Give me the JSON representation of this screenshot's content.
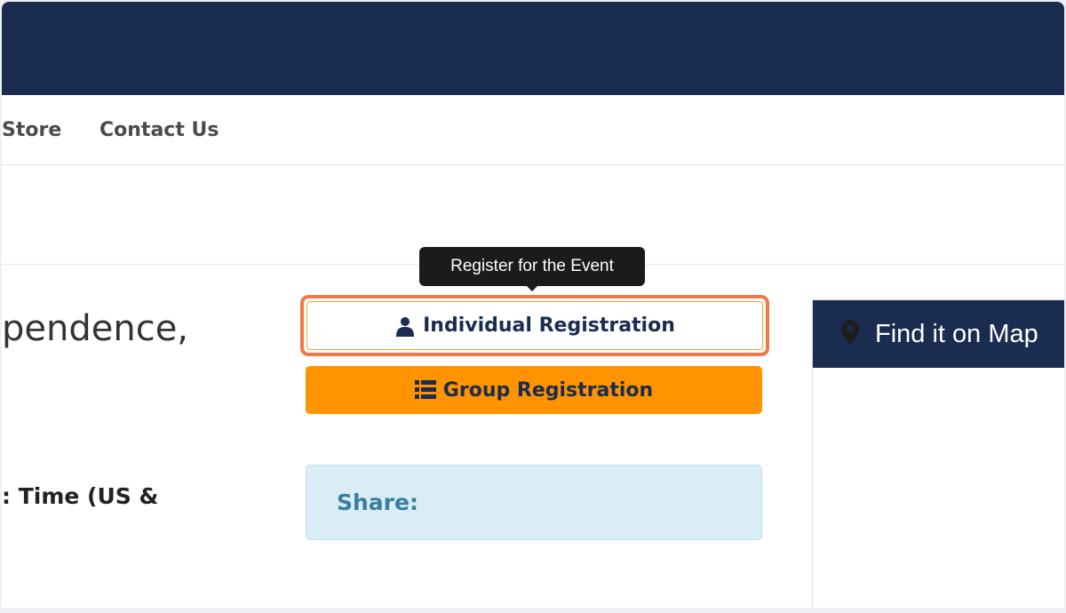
{
  "nav": {
    "items": [
      "Store",
      "Contact Us"
    ]
  },
  "event": {
    "title_fragment": "pendence,",
    "time_fragment": ": Time (US &"
  },
  "tooltip": {
    "text": "Register for the Event"
  },
  "buttons": {
    "individual_label": "Individual Registration",
    "group_label": "Group Registration"
  },
  "share": {
    "label": "Share:"
  },
  "map": {
    "title": "Find it on Map"
  },
  "icons": {
    "individual": "user-icon",
    "group": "list-icon",
    "map": "map-marker-icon"
  },
  "colors": {
    "navy": "#1a2c50",
    "orange": "#ff9300",
    "focus_ring": "#f27a4a",
    "share_bg": "#daedf6",
    "share_text": "#3a7ea3"
  }
}
